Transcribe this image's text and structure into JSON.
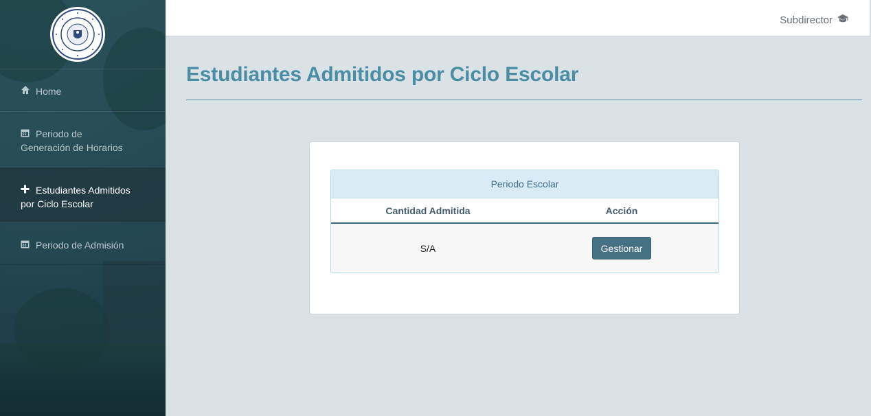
{
  "topbar": {
    "user_label": "Subdirector",
    "user_icon": "graduation-cap-icon"
  },
  "sidebar": {
    "items": [
      {
        "label": "Home",
        "icon": "home-icon"
      },
      {
        "label_line1": "Periodo de",
        "label_line2": "Generación de Horarios",
        "icon": "calendar-icon"
      },
      {
        "label_line1": "Estudiantes Admitidos",
        "label_line2": "por Ciclo Escolar",
        "icon": "plus-icon",
        "active": true
      },
      {
        "label": "Periodo de Admisión",
        "icon": "calendar-icon"
      }
    ]
  },
  "page": {
    "title": "Estudiantes Admitidos por Ciclo Escolar"
  },
  "table": {
    "caption": "Periodo Escolar",
    "columns": [
      "Cantidad Admitida",
      "Acción"
    ],
    "rows": [
      {
        "cantidad": "S/A",
        "accion_label": "Gestionar"
      }
    ]
  },
  "colors": {
    "accent": "#4a8da5",
    "button": "#467083",
    "sidebar": "#2b5560",
    "header_cell": "#d9ecf6"
  }
}
